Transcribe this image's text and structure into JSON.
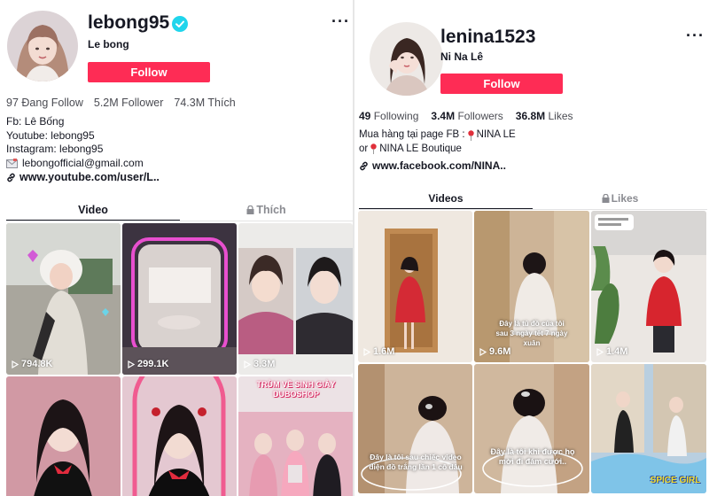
{
  "profiles": [
    {
      "username": "lebong95",
      "nickname": "Le bong",
      "verified": true,
      "follow_label": "Follow",
      "stats": [
        {
          "value": "97",
          "label": "Đang Follow"
        },
        {
          "value": "5.2M",
          "label": "Follower"
        },
        {
          "value": "74.3M",
          "label": "Thích"
        }
      ],
      "bio": [
        "Fb: Lê Bống",
        "Youtube: lebong95",
        "Instagram: lebong95",
        "lebongofficial@gmail.com"
      ],
      "link": "www.youtube.com/user/L..",
      "tabs": {
        "videos": "Video",
        "likes": "Thích"
      },
      "videos": [
        {
          "views": "794.8K"
        },
        {
          "views": "299.1K"
        },
        {
          "views": "3.3M"
        },
        {
          "views": ""
        },
        {
          "views": ""
        },
        {
          "views": "",
          "banner": "TRÙM VỀ SINH GIÀY DUBOSHOP"
        }
      ]
    },
    {
      "username": "lenina1523",
      "nickname": "Ni Na Lê",
      "verified": false,
      "follow_label": "Follow",
      "stats": [
        {
          "value": "49",
          "label": "Following"
        },
        {
          "value": "3.4M",
          "label": "Followers"
        },
        {
          "value": "36.8M",
          "label": "Likes"
        }
      ],
      "bio_line1": "Mua hàng tại page FB :",
      "bio_line1_tail": "NINA LE",
      "bio_line2": "or",
      "bio_line2_tail": "NINA LE Boutique",
      "link": "www.facebook.com/NINA..",
      "tabs": {
        "videos": "Videos",
        "likes": "Likes"
      },
      "videos": [
        {
          "views": "1.6M"
        },
        {
          "views": "9.6M",
          "caption": "Đây là tủ đồ của tôi sau 3 ngày tết 7 ngày xuân"
        },
        {
          "views": "1.4M"
        },
        {
          "views": "",
          "caption": "Đây là tôi sau chiếc video diện đồ trắng lần 1 cô dâu"
        },
        {
          "views": "",
          "caption": "Đây là tôi khi được họ mời đi đám cưới.."
        },
        {
          "views": "",
          "banner": "SPICE GIRL"
        }
      ]
    }
  ],
  "colors": {
    "accent": "#fe2c55",
    "verified": "#20d5ec",
    "text": "#161823",
    "muted": "#8a8b91"
  },
  "icons": [
    "verified-badge-icon",
    "more-dots-icon",
    "link-icon",
    "lock-icon",
    "play-icon",
    "mail-icon",
    "pin-icon"
  ]
}
